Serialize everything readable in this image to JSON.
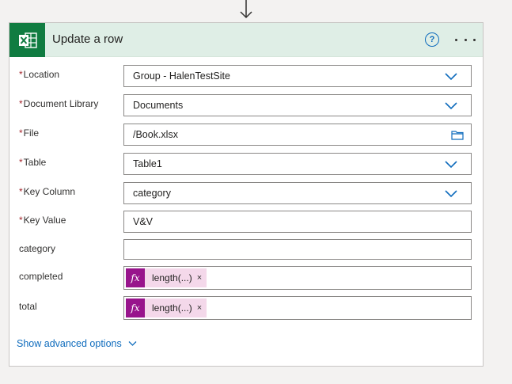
{
  "step": {
    "title": "Update a row",
    "app_icon": "excel-icon",
    "help_label": "?"
  },
  "fields": [
    {
      "label": "Location",
      "required": true,
      "value": "Group - HalenTestSite",
      "control": "dropdown"
    },
    {
      "label": "Document Library",
      "required": true,
      "value": "Documents",
      "control": "dropdown"
    },
    {
      "label": "File",
      "required": true,
      "value": "/Book.xlsx",
      "control": "file-picker"
    },
    {
      "label": "Table",
      "required": true,
      "value": "Table1",
      "control": "dropdown"
    },
    {
      "label": "Key Column",
      "required": true,
      "value": "category",
      "control": "dropdown"
    },
    {
      "label": "Key Value",
      "required": true,
      "value": "V&V",
      "control": "text"
    },
    {
      "label": "category",
      "required": false,
      "value": "",
      "control": "text"
    },
    {
      "label": "completed",
      "required": false,
      "value": "",
      "control": "token",
      "token": {
        "symbol": "fx",
        "text": "length(...)",
        "remove": "×"
      }
    },
    {
      "label": "total",
      "required": false,
      "value": "",
      "control": "token",
      "token": {
        "symbol": "fx",
        "text": "length(...)",
        "remove": "×"
      }
    }
  ],
  "required_marker": "*",
  "show_advanced": "Show advanced options",
  "colors": {
    "header_bg": "#dfeee6",
    "excel_green": "#107c41",
    "accent_blue": "#0f6cbd",
    "token_bg": "#f4d8ea",
    "token_fx_bg": "#98148c",
    "required_red": "#a4262c"
  }
}
